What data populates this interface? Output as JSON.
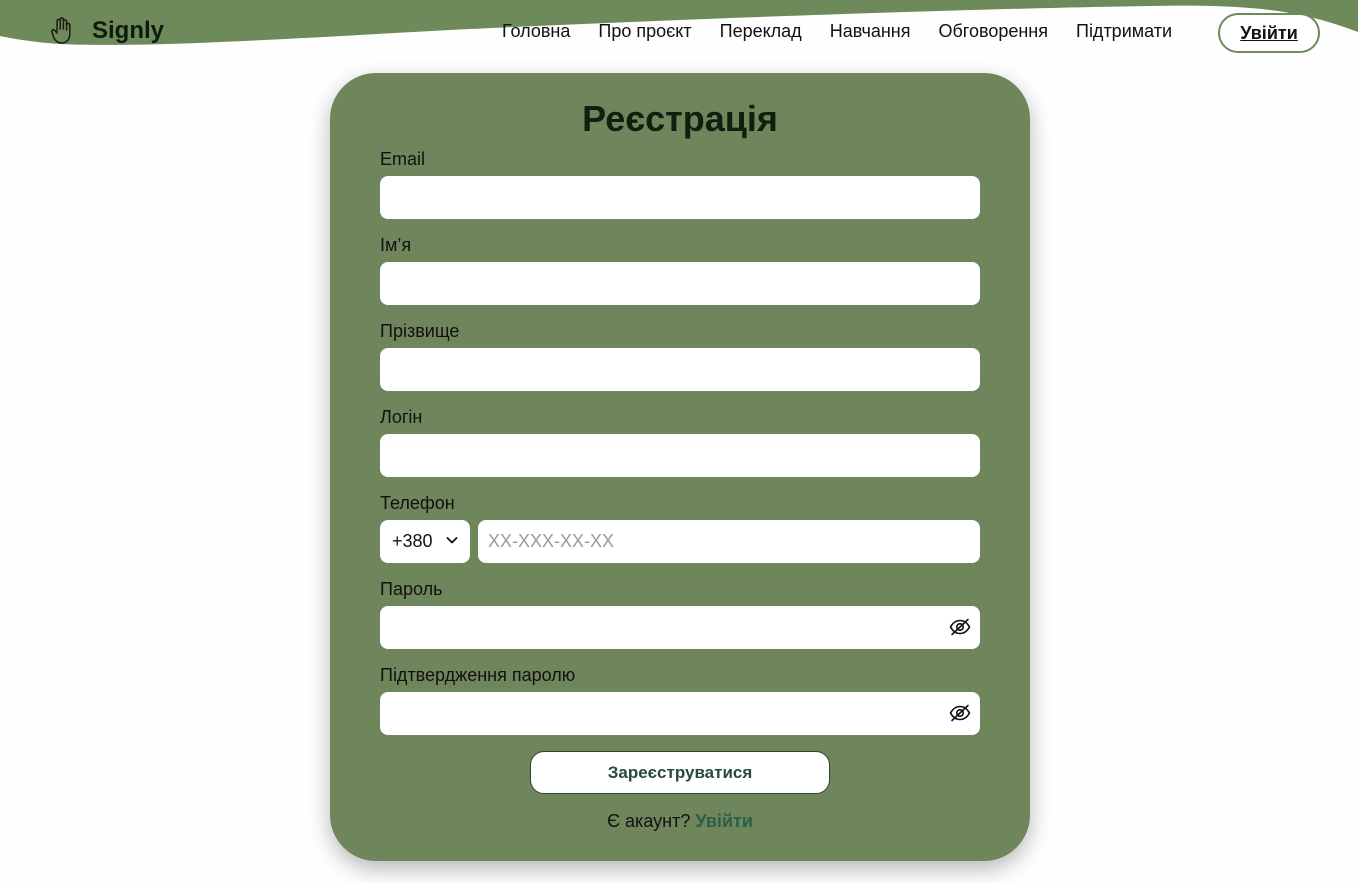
{
  "header": {
    "brand": "Signly",
    "logo_icon": "hand-icon",
    "nav": [
      "Головна",
      "Про проєкт",
      "Переклад",
      "Навчання",
      "Обговорення",
      "Підтримати"
    ],
    "login_label": "Увійти",
    "accent_color": "#6f8a5a"
  },
  "form": {
    "title": "Реєстрація",
    "email_label": "Email",
    "email_value": "",
    "first_name_label": "Ім’я",
    "first_name_value": "",
    "last_name_label": "Прізвище",
    "last_name_value": "",
    "login_label": "Логін",
    "login_value": "",
    "phone_label": "Телефон",
    "phone_code": "+380",
    "phone_placeholder": "XX-XXX-XX-XX",
    "password_label": "Пароль",
    "password_value": "",
    "confirm_label": "Підтвердження паролю",
    "confirm_value": "",
    "eye_icon": "eye-off-icon",
    "submit_label": "Зареєструватися",
    "have_account_text": "Є акаунт?",
    "have_account_link": "Увійти",
    "card_color": "#6f855b"
  }
}
